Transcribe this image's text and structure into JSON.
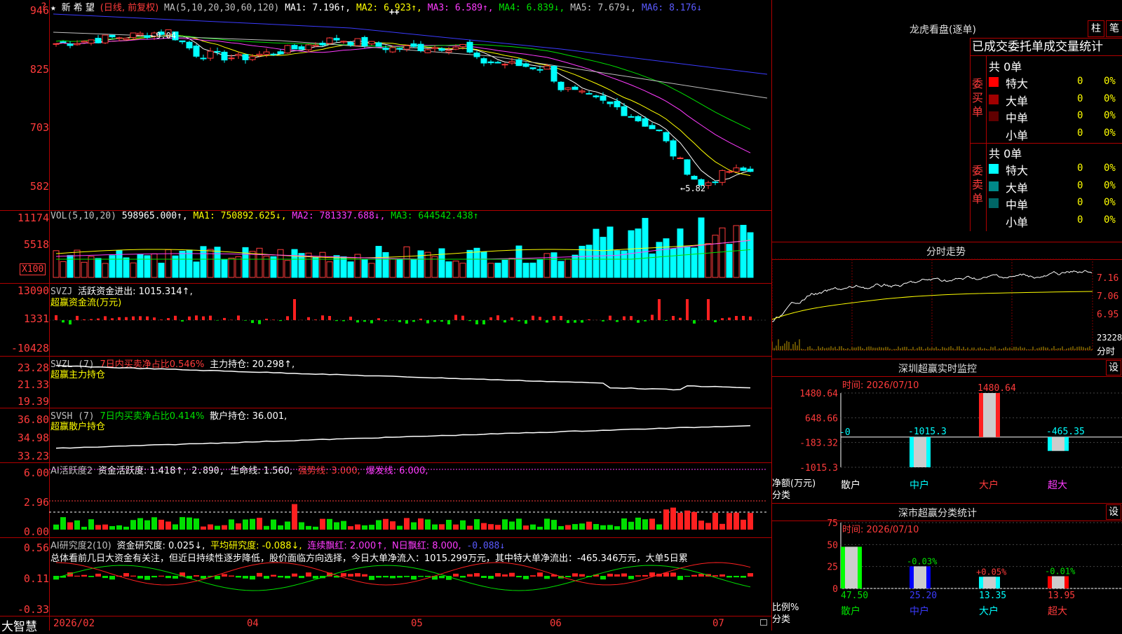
{
  "main": {
    "title_glyph": "★",
    "stock_name": "新 希 望",
    "period": "(日线, 前复权)",
    "ma_label": "MA(5,10,20,30,60,120)",
    "ma1": "MA1: 7.196↑,",
    "ma2": "MA2: 6.923↑,",
    "ma3": "MA3: 6.589↑,",
    "ma4": "MA4: 6.839↓,",
    "ma5": "MA5: 7.679↓,",
    "ma6": "MA6: 8.176↓",
    "marks": "++",
    "y_ticks": [
      "946",
      "825",
      "703",
      "582"
    ],
    "high_label": "9.04",
    "low_label": "5.82",
    "question": "?",
    "colors": {
      "up": "#ff3b3b",
      "down": "#00ffff",
      "ma1": "#ffffff",
      "ma2": "#ffff00",
      "ma3": "#ff3bff",
      "ma4": "#00e000",
      "ma5": "#c0c0c0",
      "ma6": "#3b3bff"
    }
  },
  "vol": {
    "label": "VOL(5,10,20)",
    "value": "598965.000↑,",
    "ma1": "MA1: 750892.625↓,",
    "ma2": "MA2: 781337.688↓,",
    "ma3": "MA3: 644542.438↑",
    "y_ticks": [
      "11174",
      "5518"
    ],
    "unit": "X100"
  },
  "svzj": {
    "label": "SVZJ",
    "desc": "活跃资金进出: 1015.314↑,",
    "sub": "超赢资金流(万元)",
    "y_ticks": [
      "13090",
      "1331",
      "-10428"
    ]
  },
  "svzl": {
    "label": "SVZL (7)",
    "pct": "7日内买卖净占比0.546%",
    "hold": "主力持仓: 20.298↑,",
    "sub": "超赢主力持仓",
    "y_ticks": [
      "23.28",
      "21.33",
      "19.39"
    ]
  },
  "svsh": {
    "label": "SVSH (7)",
    "pct": "7日内买卖净占比0.414%",
    "hold": "散户持仓: 36.001,",
    "sub": "超赢散户持仓",
    "y_ticks": [
      "36.80",
      "34.98",
      "33.23"
    ]
  },
  "ai1": {
    "label": "AI活跃度2",
    "a": "资金活跃度: 1.418↑,",
    "b": "2.890,",
    "c": "生命线: 1.560,",
    "d": "强势线: 3.000,",
    "e": "爆发线: 6.000,",
    "y_ticks": [
      "6.00",
      "2.96",
      "0.00"
    ]
  },
  "ai2": {
    "label": "AI研究度2(10)",
    "a": "资金研究度: 0.025↓,",
    "b": "平均研究度: -0.088↓,",
    "c": "连续飘红: 2.000↑,",
    "d": "N日飘红: 8.000,",
    "e": "-0.088↓",
    "comment": "总体看前几日大资金有关注，但近日持续性逐步降低，股价面临方向选择，今日大单净流入：1015.299万元，其中特大单净流出：-465.346万元，大单5日累",
    "y_ticks": [
      "0.56",
      "0.11",
      "-0.33"
    ]
  },
  "xaxis": {
    "brand": "大智慧",
    "labels": [
      "2026/02",
      "04",
      "05",
      "06",
      "07"
    ]
  },
  "longhu": {
    "title": "龙虎看盘(逐单)",
    "btn1": "柱",
    "btn2": "笔",
    "header": "已成交委托单成交量统计",
    "buy": {
      "side": "委买单",
      "total": "共 0单",
      "rows": [
        {
          "name": "特大",
          "v": "0",
          "p": "0%",
          "c": "#ff0000"
        },
        {
          "name": "大单",
          "v": "0",
          "p": "0%",
          "c": "#a00000"
        },
        {
          "name": "中单",
          "v": "0",
          "p": "0%",
          "c": "#600000"
        },
        {
          "name": "小单",
          "v": "0",
          "p": "0%",
          "c": "#000000"
        }
      ]
    },
    "sell": {
      "side": "委卖单",
      "total": "共 0单",
      "rows": [
        {
          "name": "特大",
          "v": "0",
          "p": "0%",
          "c": "#00ffff"
        },
        {
          "name": "大单",
          "v": "0",
          "p": "0%",
          "c": "#008888"
        },
        {
          "name": "中单",
          "v": "0",
          "p": "0%",
          "c": "#006666"
        },
        {
          "name": "小单",
          "v": "0",
          "p": "0%",
          "c": "#000000"
        }
      ]
    }
  },
  "fenshi": {
    "title": "分时走势",
    "y_ticks": [
      "7.16",
      "7.06",
      "6.95"
    ],
    "vol_tick": "23228",
    "vol_label": "分时"
  },
  "sz_monitor": {
    "title": "深圳超赢实时监控",
    "btn": "设",
    "time": "时间: 2026/07/10",
    "y_ticks": [
      "1480.64",
      "648.66",
      "-183.32",
      "-1015.3"
    ],
    "ylabel": "净额(万元)",
    "xlabel": "分类",
    "chart_data": {
      "type": "bar",
      "categories": [
        "散户",
        "中户",
        "大户",
        "超大"
      ],
      "values": [
        0,
        -1015.3,
        1480.64,
        -465.35
      ],
      "value_labels": [
        "-0",
        "-1015.3",
        "1480.64",
        "-465.35"
      ],
      "ylim": [
        -1015.3,
        1480.64
      ]
    }
  },
  "sz_class": {
    "title": "深市超赢分类统计",
    "btn": "设",
    "time": "时间: 2026/07/10",
    "y_ticks": [
      "75",
      "50",
      "25",
      "0"
    ],
    "ylabel": "比例%",
    "xlabel": "分类",
    "chart_data": {
      "type": "bar",
      "categories": [
        "散户",
        "中户",
        "大户",
        "超大"
      ],
      "values": [
        47.5,
        25.2,
        13.35,
        13.95
      ],
      "changes": [
        "",
        "-0.03%",
        "+0.05%",
        "-0.01%"
      ],
      "ylim": [
        0,
        75
      ],
      "colors": [
        "#00ff00",
        "#0000ff",
        "#00ffff",
        "#ff0000"
      ]
    }
  }
}
